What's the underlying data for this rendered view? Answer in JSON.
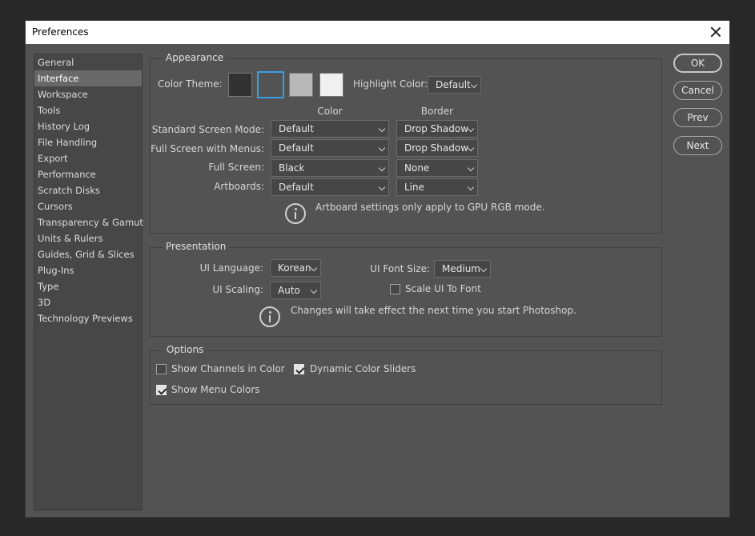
{
  "window": {
    "title": "Preferences"
  },
  "sidebar": {
    "items": [
      {
        "label": "General"
      },
      {
        "label": "Interface",
        "selected": true
      },
      {
        "label": "Workspace"
      },
      {
        "label": "Tools"
      },
      {
        "label": "History Log"
      },
      {
        "label": "File Handling"
      },
      {
        "label": "Export"
      },
      {
        "label": "Performance"
      },
      {
        "label": "Scratch Disks"
      },
      {
        "label": "Cursors"
      },
      {
        "label": "Transparency & Gamut"
      },
      {
        "label": "Units & Rulers"
      },
      {
        "label": "Guides, Grid & Slices"
      },
      {
        "label": "Plug-Ins"
      },
      {
        "label": "Type"
      },
      {
        "label": "3D"
      },
      {
        "label": "Technology Previews"
      }
    ]
  },
  "appearance": {
    "legend": "Appearance",
    "color_theme_label": "Color Theme:",
    "themes": [
      {
        "name": "dark",
        "color": "#323232"
      },
      {
        "name": "medium-dark",
        "color": "#535353",
        "selected": true
      },
      {
        "name": "medium-light",
        "color": "#b8b8b8"
      },
      {
        "name": "light",
        "color": "#f0f0f0"
      }
    ],
    "highlight_color_label": "Highlight Color:",
    "highlight_color_value": "Default",
    "col_color": "Color",
    "col_border": "Border",
    "rows": [
      {
        "label": "Standard Screen Mode:",
        "color": "Default",
        "border": "Drop Shadow"
      },
      {
        "label": "Full Screen with Menus:",
        "color": "Default",
        "border": "Drop Shadow"
      },
      {
        "label": "Full Screen:",
        "color": "Black",
        "border": "None"
      },
      {
        "label": "Artboards:",
        "color": "Default",
        "border": "Line"
      }
    ],
    "info_text": "Artboard settings only apply to GPU RGB mode."
  },
  "presentation": {
    "legend": "Presentation",
    "ui_language_label": "UI Language:",
    "ui_language_value": "Korean",
    "ui_font_size_label": "UI Font Size:",
    "ui_font_size_value": "Medium",
    "ui_scaling_label": "UI Scaling:",
    "ui_scaling_value": "Auto",
    "scale_ui_label": "Scale UI To Font",
    "scale_ui_checked": false,
    "info_text": "Changes will take effect the next time you start Photoshop."
  },
  "options": {
    "legend": "Options",
    "show_channels_label": "Show Channels in Color",
    "show_channels_checked": false,
    "dynamic_sliders_label": "Dynamic Color Sliders",
    "dynamic_sliders_checked": true,
    "show_menu_colors_label": "Show Menu Colors",
    "show_menu_colors_checked": true
  },
  "buttons": {
    "ok": "OK",
    "cancel": "Cancel",
    "prev": "Prev",
    "next": "Next"
  },
  "colors": {
    "accent": "#39a0e6",
    "panel": "#535353"
  }
}
